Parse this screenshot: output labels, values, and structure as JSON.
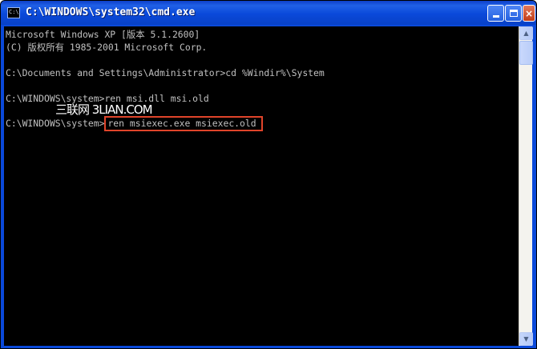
{
  "window": {
    "title": "C:\\WINDOWS\\system32\\cmd.exe",
    "buttons": {
      "minimize": "_",
      "maximize": "□",
      "close": "×"
    }
  },
  "console": {
    "lines": [
      "Microsoft Windows XP [版本 5.1.2600]",
      "(C) 版权所有 1985-2001 Microsoft Corp.",
      "",
      "C:\\Documents and Settings\\Administrator>cd %Windir%\\System",
      "",
      "C:\\WINDOWS\\system>ren msi.dll msi.old",
      ""
    ],
    "last_prompt": "C:\\WINDOWS\\system>",
    "last_command": "ren msiexec.exe msiexec.old",
    "highlight_color": "#e0442a",
    "text_color": "#c0c0c0"
  },
  "watermark": "三联网 3LIAN.COM",
  "scrollbar": {
    "up_icon": "▲",
    "down_icon": "▼"
  }
}
